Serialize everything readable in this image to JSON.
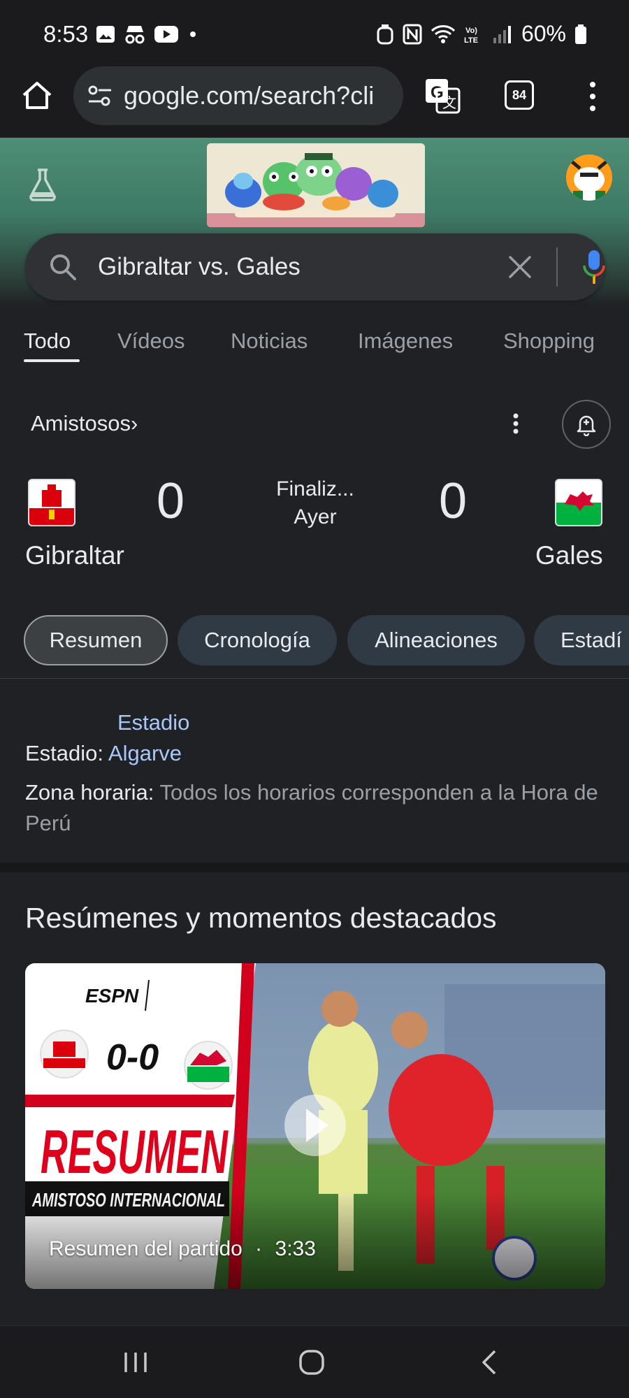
{
  "status_bar": {
    "time": "8:53",
    "battery": "60%"
  },
  "browser": {
    "url": "google.com/search?cli",
    "tab_count": "84"
  },
  "search": {
    "query": "Gibraltar vs. Gales"
  },
  "tabs": [
    {
      "label": "Todo",
      "active": true
    },
    {
      "label": "Vídeos",
      "active": false
    },
    {
      "label": "Noticias",
      "active": false
    },
    {
      "label": "Imágenes",
      "active": false
    },
    {
      "label": "Shopping",
      "active": false
    }
  ],
  "match": {
    "league": "Amistosos",
    "league_chevron": "›",
    "home_team": "Gibraltar",
    "away_team": "Gales",
    "home_score": "0",
    "away_score": "0",
    "status": "Finaliz...",
    "day": "Ayer"
  },
  "chips": [
    {
      "label": "Resumen",
      "active": true
    },
    {
      "label": "Cronología",
      "active": false
    },
    {
      "label": "Alineaciones",
      "active": false
    },
    {
      "label": "Estadí",
      "active": false
    }
  ],
  "info": {
    "stadium_link_top": "Estadio",
    "stadium_label": "Estadio:",
    "stadium_value": "Algarve",
    "timezone_label": "Zona horaria:",
    "timezone_value": "Todos los horarios corresponden a la Hora de Perú"
  },
  "highlights": {
    "title": "Resúmenes y momentos destacados",
    "video": {
      "brand": "ESPN",
      "score": "0-0",
      "banner": "RESUMEN",
      "subbanner": "AMISTOSO INTERNACIONAL",
      "caption": "Resumen del partido",
      "separator": "·",
      "duration": "3:33"
    }
  },
  "colors": {
    "accent_link": "#a8c7fa",
    "header_green": "#4e8e76",
    "background": "#202124"
  }
}
